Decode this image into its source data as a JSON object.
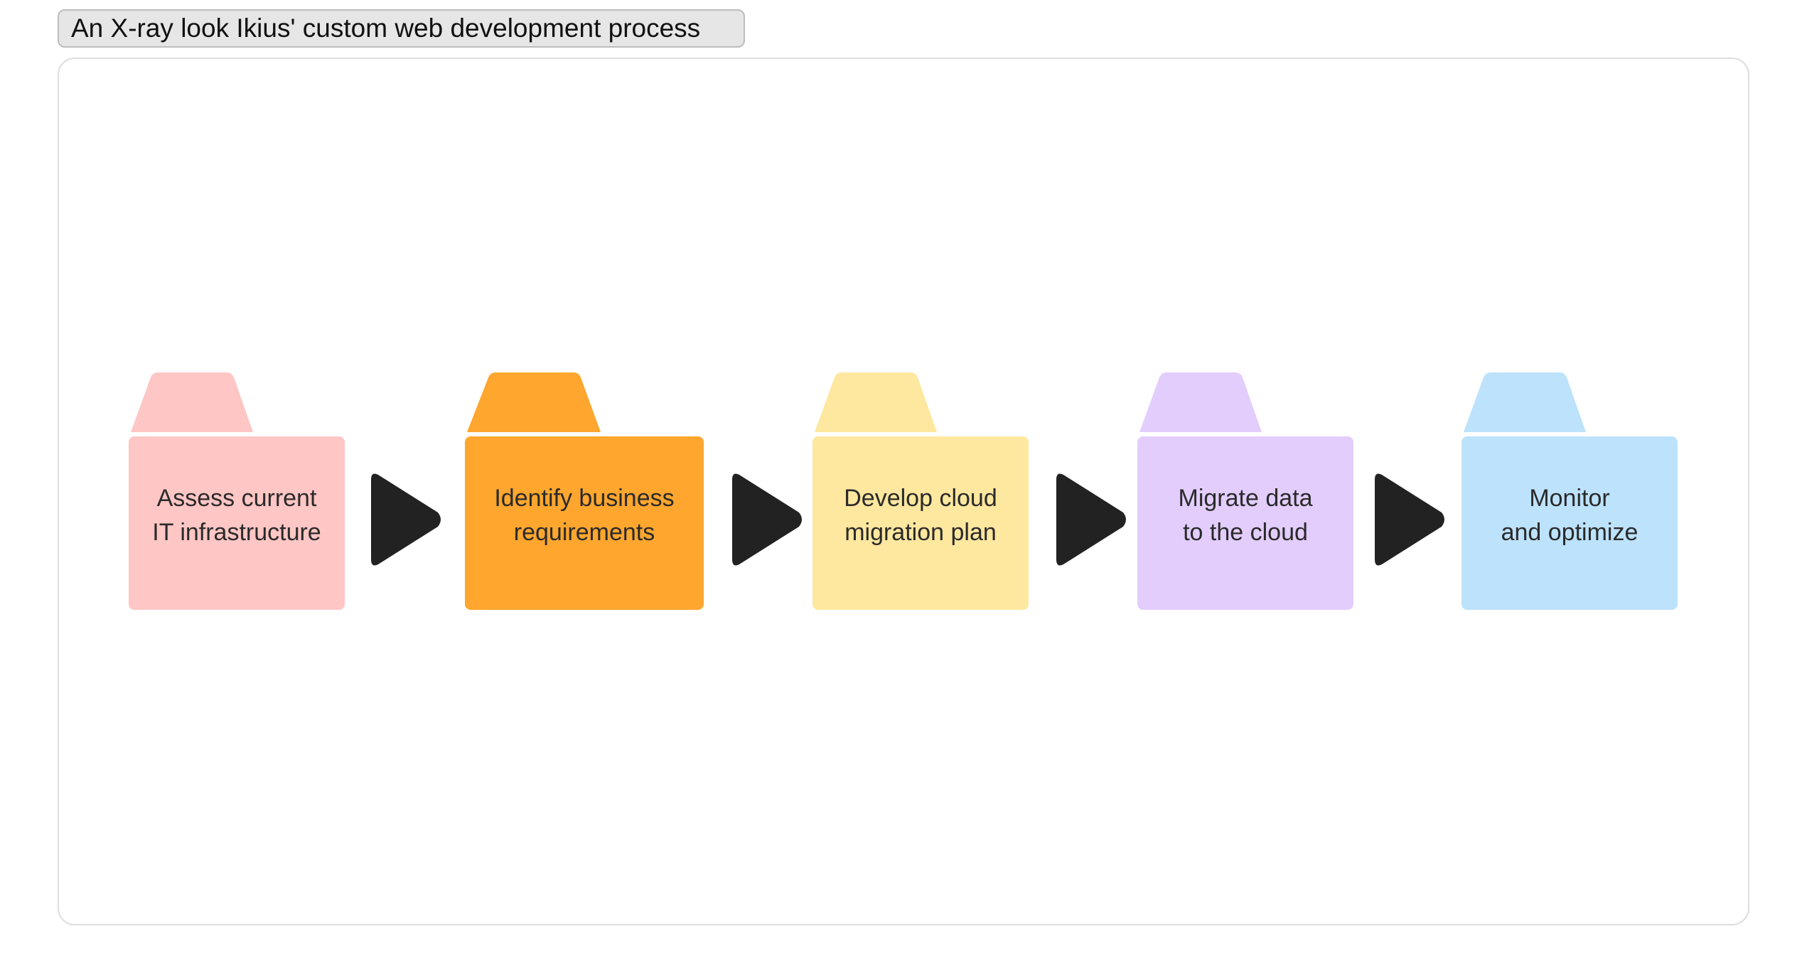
{
  "title": "An X-ray look Ikius' custom web development process",
  "steps": [
    {
      "label": "Assess current\nIT infrastructure",
      "color": "#fec6c4"
    },
    {
      "label": "Identify business\nrequirements",
      "color": "#fea62e"
    },
    {
      "label": "Develop cloud\nmigration plan",
      "color": "#fee79f"
    },
    {
      "label": "Migrate data\nto the cloud",
      "color": "#e3cdfd"
    },
    {
      "label": "Monitor\nand optimize",
      "color": "#bde2fc"
    }
  ],
  "arrow_color": "#222222"
}
